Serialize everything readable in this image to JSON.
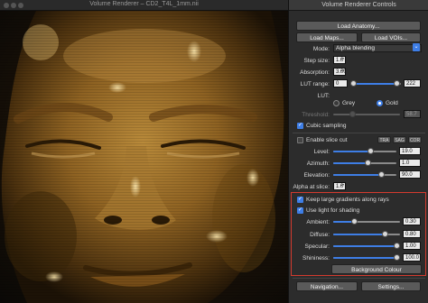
{
  "render_window": {
    "title": "Volume Renderer – CD2_T4L_1mm.nii"
  },
  "panel": {
    "title": "Volume Renderer Controls",
    "load_anatomy": "Load Anatomy...",
    "load_maps": "Load Maps...",
    "load_vois": "Load VOIs...",
    "mode_label": "Mode:",
    "mode_value": "Alpha blending",
    "step_size_label": "Step size:",
    "step_size_value": "1.0",
    "absorption_label": "Absorption:",
    "absorption_value": "3.00",
    "lut_range_label": "LUT range:",
    "lut_range_min": "0",
    "lut_range_max": "222",
    "lut_label": "LUT:",
    "lut_options": [
      "Grey",
      "Gold"
    ],
    "lut_selected": "Gold",
    "threshold_label": "Threshold:",
    "threshold_value": "58.7",
    "cubic_sampling_label": "Cubic sampling",
    "cubic_sampling_checked": true,
    "enable_slice_cut_label": "Enable slice cut",
    "enable_slice_cut_checked": false,
    "views": [
      "TRA",
      "SAG",
      "COR"
    ],
    "level_label": "Level:",
    "level_value": "19.0",
    "level_fraction": 0.6,
    "azimuth_label": "Azimuth:",
    "azimuth_value": "1.0",
    "azimuth_fraction": 0.55,
    "elevation_label": "Elevation:",
    "elevation_value": "90.0",
    "elevation_fraction": 0.8,
    "alpha_at_slice_label": "Alpha at slice:",
    "alpha_at_slice_value": "1.0",
    "keep_gradients_label": "Keep large gradients along rays",
    "keep_gradients_checked": true,
    "use_light_label": "Use light for shading",
    "use_light_checked": true,
    "ambient_label": "Ambient:",
    "ambient_value": "0.30",
    "ambient_fraction": 0.3,
    "diffuse_label": "Diffuse:",
    "diffuse_value": "0.80",
    "diffuse_fraction": 0.8,
    "specular_label": "Specular:",
    "specular_value": "1.00",
    "specular_fraction": 1.0,
    "shininess_label": "Shininess:",
    "shininess_value": "100.0",
    "shininess_fraction": 1.0,
    "background_colour": "Background Colour",
    "navigation": "Navigation...",
    "settings": "Settings..."
  },
  "colors": {
    "accent": "#3e7ee6",
    "highlight_box": "#d43a2e",
    "volume_tint": "#c89a3a"
  }
}
